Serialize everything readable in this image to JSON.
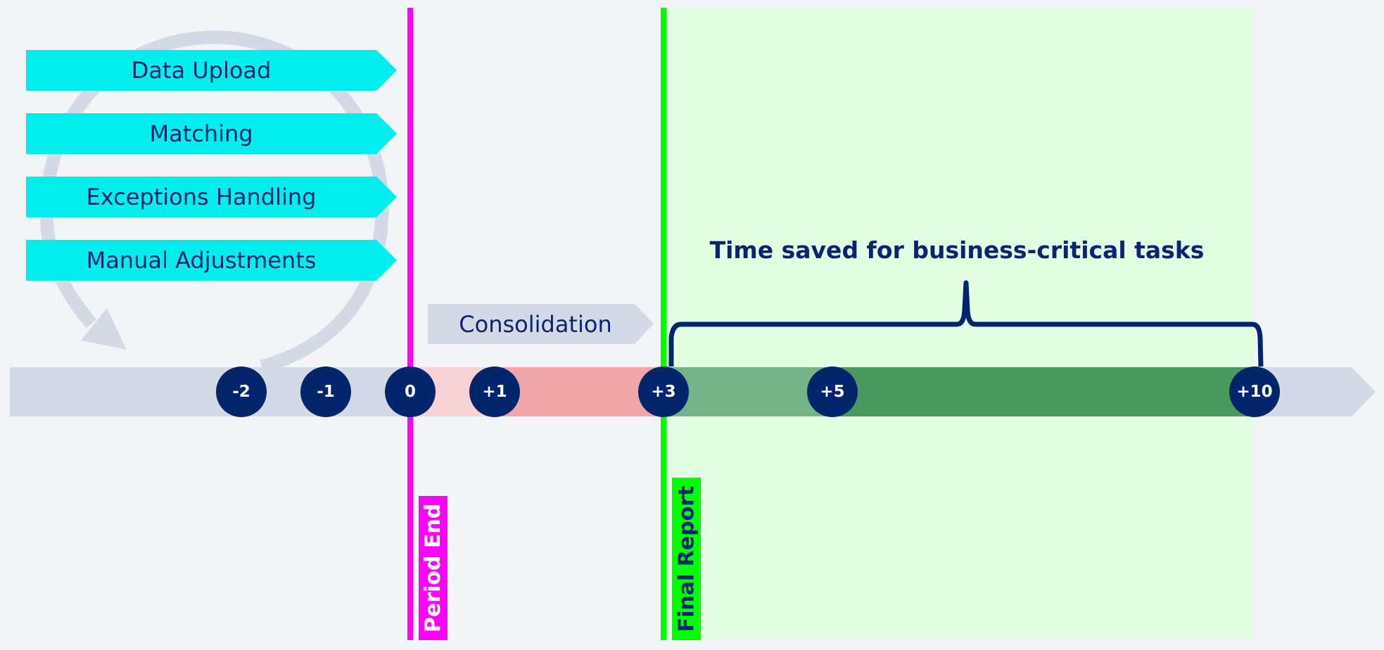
{
  "colors": {
    "background": "#f2f4f8",
    "navy": "#03256c",
    "cyan": "#00eeee",
    "gray_bar": "#d3dae6",
    "magenta": "#ff00ff",
    "green_line": "#00ff00",
    "saved_zone": "#e3fde3",
    "pink_light": "#f8d3d6",
    "pink_dark": "#f0a6a8",
    "green_light": "#75b388",
    "green_dark": "#4a9a60"
  },
  "pre_close_steps": [
    {
      "label": "Data Upload"
    },
    {
      "label": "Matching"
    },
    {
      "label": "Exceptions Handling"
    },
    {
      "label": "Manual Adjustments"
    }
  ],
  "consolidation": {
    "label": "Consolidation"
  },
  "saved_annotation": {
    "label": "Time saved for business-critical tasks"
  },
  "markers": {
    "period_end": {
      "label": "Period End",
      "day": 0
    },
    "final_report": {
      "label": "Final Report",
      "day": 3
    }
  },
  "timeline": {
    "milestones": [
      {
        "label": "-2",
        "day": -2
      },
      {
        "label": "-1",
        "day": -1
      },
      {
        "label": "0",
        "day": 0
      },
      {
        "label": "+1",
        "day": 1
      },
      {
        "label": "+3",
        "day": 3
      },
      {
        "label": "+5",
        "day": 5
      },
      {
        "label": "+10",
        "day": 10
      }
    ],
    "segments": [
      {
        "from": 0,
        "to": 1,
        "color_key": "pink_light"
      },
      {
        "from": 1,
        "to": 3,
        "color_key": "pink_dark"
      },
      {
        "from": 3,
        "to": 5,
        "color_key": "green_light"
      },
      {
        "from": 5,
        "to": 10,
        "color_key": "green_dark"
      }
    ],
    "saved_range": {
      "from": 3,
      "to": 10
    }
  }
}
